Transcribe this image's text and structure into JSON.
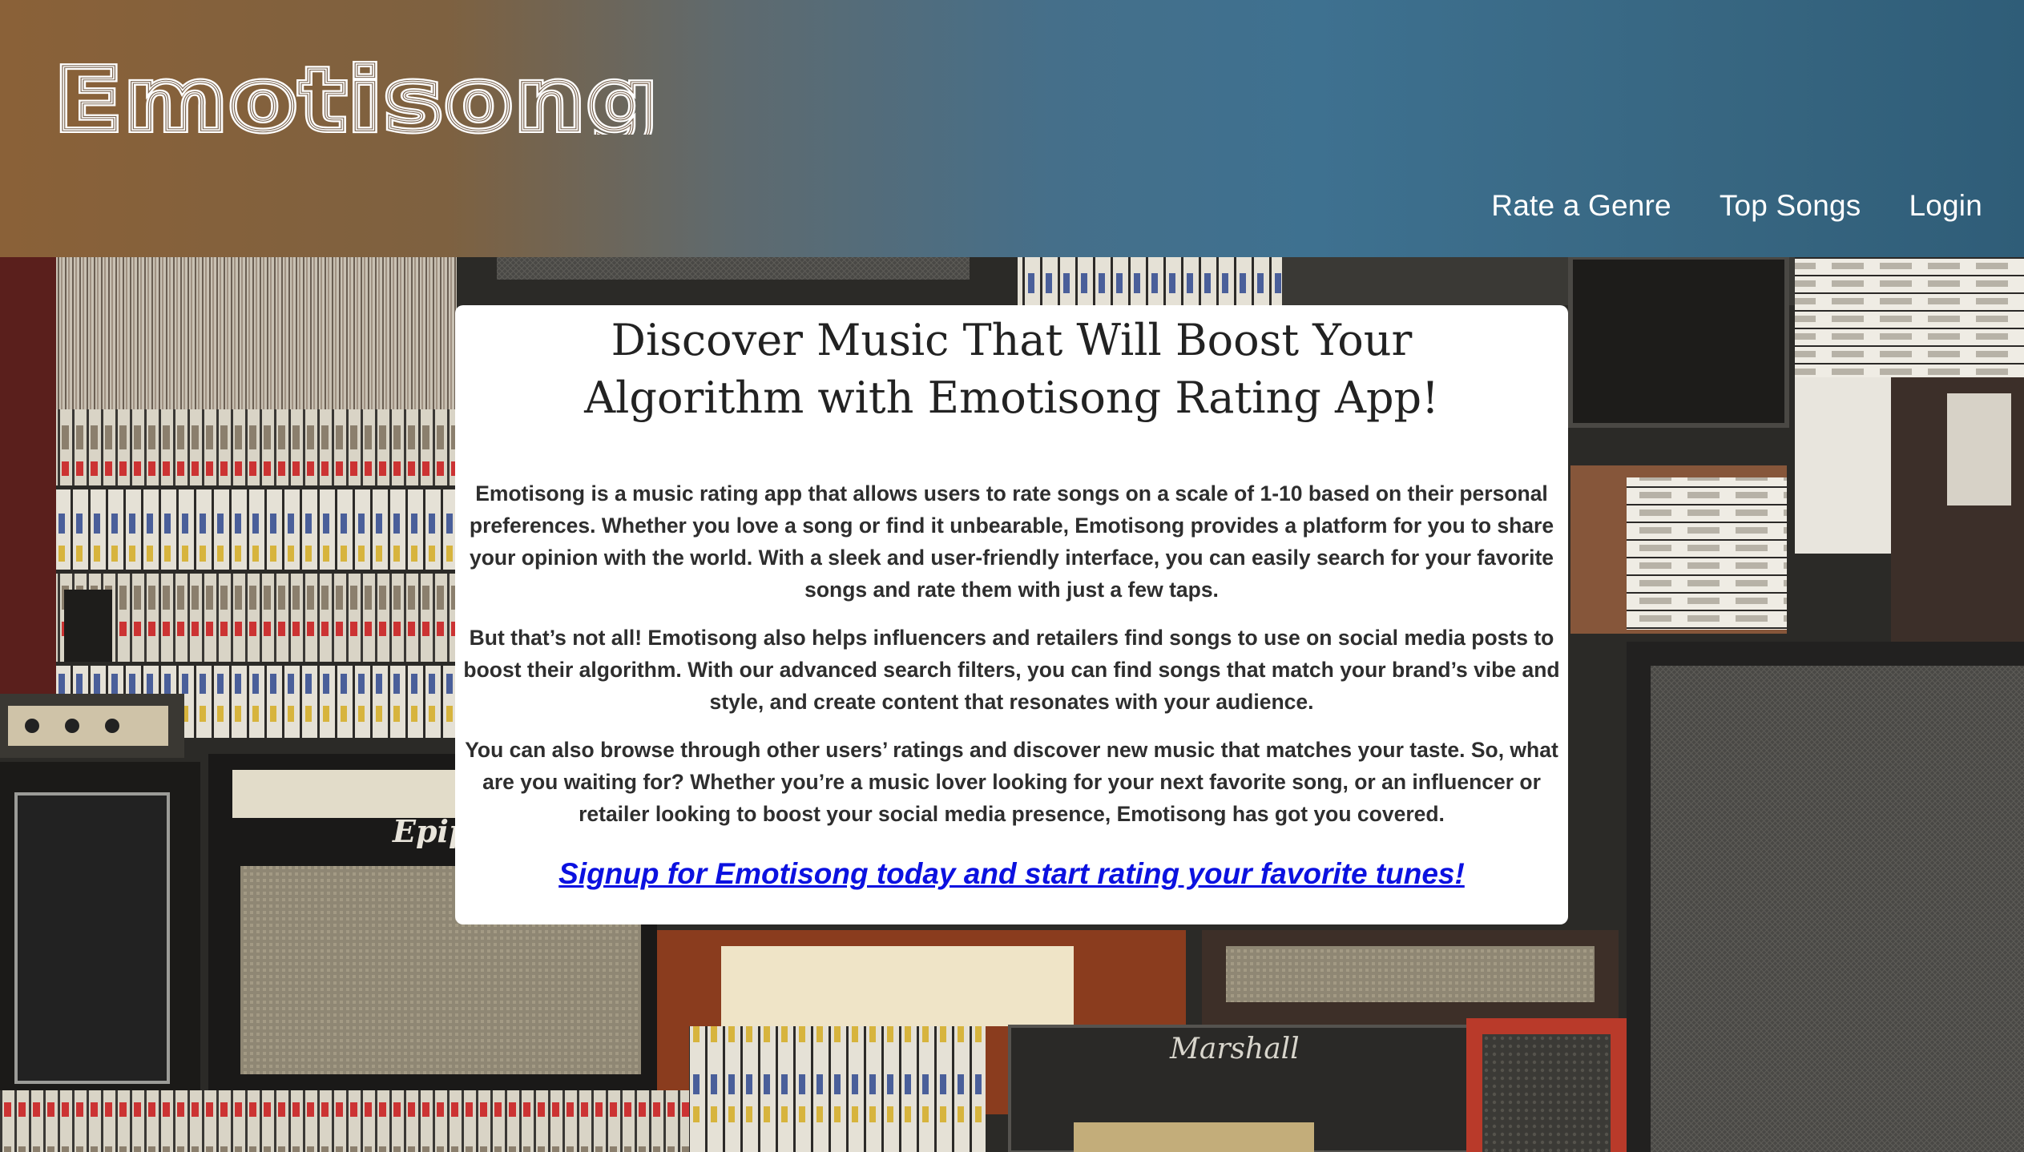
{
  "header": {
    "logo_text": "Emotisong",
    "nav": {
      "rate_genre": "Rate a Genre",
      "top_songs": "Top Songs",
      "login": "Login"
    }
  },
  "main": {
    "title": "Discover Music That Will Boost Your Algorithm with Emotisong Rating App!",
    "paragraphs": [
      "Emotisong is a music rating app that allows users to rate songs on a scale of 1-10 based on their personal preferences. Whether you love a song or find it unbearable, Emotisong provides a platform for you to share your opinion with the world. With a sleek and user-friendly interface, you can easily search for your favorite songs and rate them with just a few taps.",
      "But that’s not all! Emotisong also helps influencers and retailers find songs to use on social media posts to boost their algorithm. With our advanced search filters, you can find songs that match your brand’s vibe and style, and create content that resonates with your audience.",
      "You can also browse through other users’ ratings and discover new music that matches your taste. So, what are you waiting for? Whether you’re a music lover looking for your next favorite song, or an influencer or retailer looking to boost your social media presence, Emotisong has got you covered."
    ],
    "cta": "Signup for Emotisong today and start rating your favorite tunes!"
  },
  "background": {
    "amp_brand_1": "Epiph",
    "amp_brand_2": "Marshall"
  },
  "colors": {
    "header_left": "#8a6138",
    "header_right": "#2f5d78",
    "link_blue": "#0b11e0"
  }
}
